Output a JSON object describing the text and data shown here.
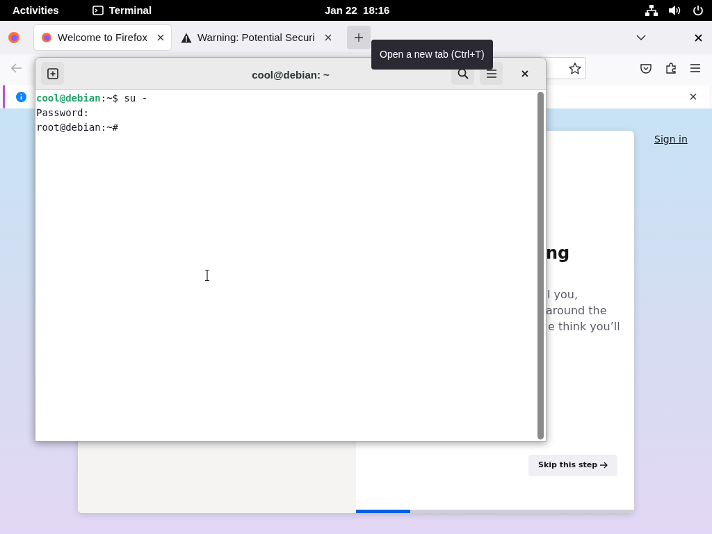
{
  "top_bar": {
    "activities": "Activities",
    "app": "Terminal",
    "clock": "Jan 22  18:16"
  },
  "browser": {
    "tabs": [
      {
        "title": "Welcome to Firefox",
        "selected": true,
        "kind": "page"
      },
      {
        "title": "Warning: Potential Securi",
        "selected": false,
        "kind": "warning"
      }
    ],
    "new_tab_tooltip": "Open a new tab (Ctrl+T)",
    "page": {
      "sign_in": "Sign in",
      "heading": "ng",
      "body_lines": [
        "l you,",
        "around the",
        "e think you’ll"
      ],
      "skip_button": "Skip this step",
      "progress": {
        "level": 0.195
      }
    }
  },
  "terminal": {
    "title": "cool@debian: ~",
    "lines": [
      {
        "user": "cool@debian",
        "text": ":~$ su -"
      },
      {
        "text": "Password:"
      },
      {
        "text": "root@debian:~#"
      }
    ]
  }
}
